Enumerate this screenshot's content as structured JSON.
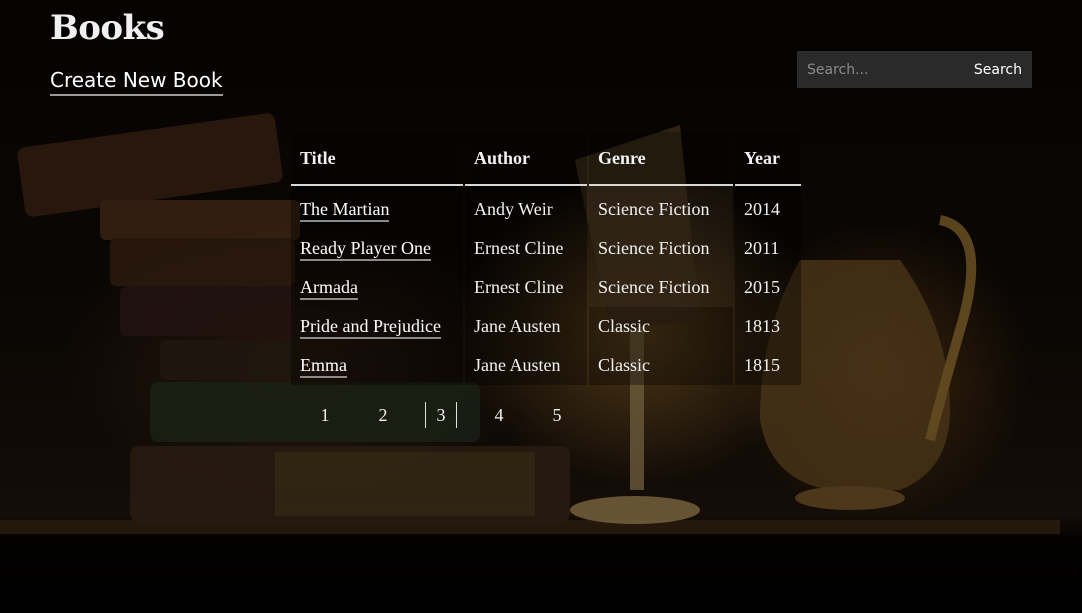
{
  "page": {
    "title": "Books",
    "create_link": "Create New Book"
  },
  "search": {
    "placeholder": "Search...",
    "value": "",
    "button_label": "Search"
  },
  "table": {
    "headers": [
      "Title",
      "Author",
      "Genre",
      "Year"
    ],
    "rows": [
      {
        "title": "The Martian",
        "author": "Andy Weir",
        "genre": "Science Fiction",
        "year": "2014"
      },
      {
        "title": "Ready Player One",
        "author": "Ernest Cline",
        "genre": "Science Fiction",
        "year": "2011"
      },
      {
        "title": "Armada",
        "author": "Ernest Cline",
        "genre": "Science Fiction",
        "year": "2015"
      },
      {
        "title": "Pride and Prejudice",
        "author": "Jane Austen",
        "genre": "Classic",
        "year": "1813"
      },
      {
        "title": "Emma",
        "author": "Jane Austen",
        "genre": "Classic",
        "year": "1815"
      }
    ]
  },
  "pagination": {
    "pages": [
      "1",
      "2",
      "3",
      "4",
      "5"
    ],
    "current": "3"
  },
  "colors": {
    "background": "#000000",
    "text": "#f2f2f2",
    "search_bg": "#2a2a2a"
  }
}
